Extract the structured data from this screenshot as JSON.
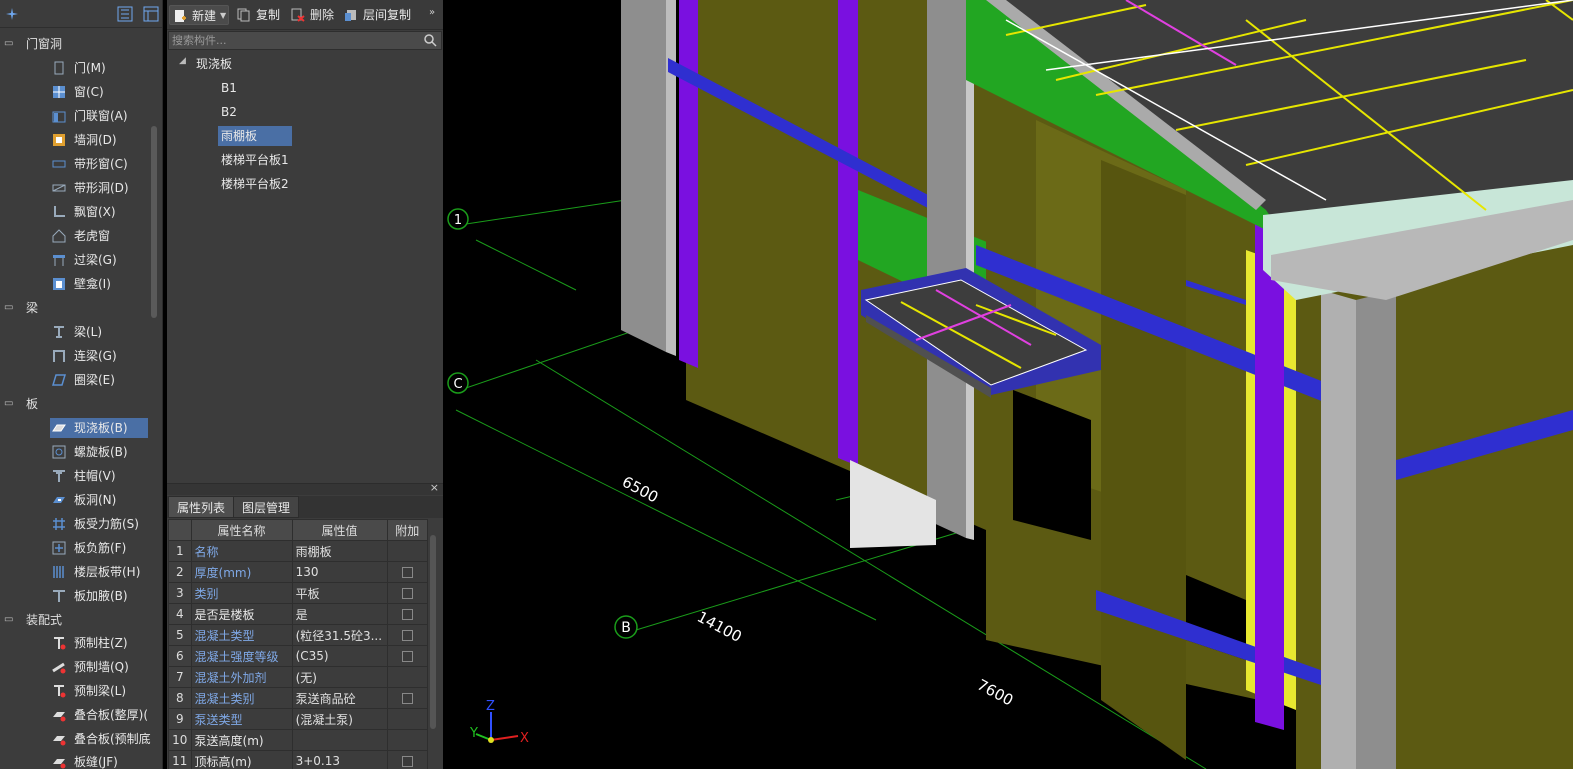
{
  "nav": {
    "categories": [
      {
        "label": "门窗洞",
        "items": [
          {
            "label": "门(M)",
            "icon": "door-icon"
          },
          {
            "label": "窗(C)",
            "icon": "window-icon"
          },
          {
            "label": "门联窗(A)",
            "icon": "door-window-icon"
          },
          {
            "label": "墙洞(D)",
            "icon": "wall-opening-icon"
          },
          {
            "label": "带形窗(C)",
            "icon": "strip-window-icon"
          },
          {
            "label": "带形洞(D)",
            "icon": "strip-opening-icon"
          },
          {
            "label": "飘窗(X)",
            "icon": "bay-window-icon"
          },
          {
            "label": "老虎窗",
            "icon": "dormer-icon"
          },
          {
            "label": "过梁(G)",
            "icon": "lintel-icon"
          },
          {
            "label": "壁龛(I)",
            "icon": "niche-icon"
          }
        ]
      },
      {
        "label": "梁",
        "items": [
          {
            "label": "梁(L)",
            "icon": "beam-icon"
          },
          {
            "label": "连梁(G)",
            "icon": "coupling-beam-icon"
          },
          {
            "label": "圈梁(E)",
            "icon": "ring-beam-icon"
          }
        ]
      },
      {
        "label": "板",
        "items": [
          {
            "label": "现浇板(B)",
            "icon": "cast-slab-icon"
          },
          {
            "label": "螺旋板(B)",
            "icon": "spiral-slab-icon"
          },
          {
            "label": "柱帽(V)",
            "icon": "column-cap-icon"
          },
          {
            "label": "板洞(N)",
            "icon": "slab-hole-icon"
          },
          {
            "label": "板受力筋(S)",
            "icon": "slab-rebar-icon"
          },
          {
            "label": "板负筋(F)",
            "icon": "slab-neg-rebar-icon"
          },
          {
            "label": "楼层板带(H)",
            "icon": "slab-strip-icon"
          },
          {
            "label": "板加腋(B)",
            "icon": "slab-haunch-icon"
          }
        ]
      },
      {
        "label": "装配式",
        "items": [
          {
            "label": "预制柱(Z)",
            "icon": "precast-column-icon"
          },
          {
            "label": "预制墙(Q)",
            "icon": "precast-wall-icon"
          },
          {
            "label": "预制梁(L)",
            "icon": "precast-beam-icon"
          },
          {
            "label": "叠合板(整厚)(",
            "icon": "composite-slab-icon"
          },
          {
            "label": "叠合板(预制底",
            "icon": "composite-slab-bottom-icon"
          },
          {
            "label": "板缝(JF)",
            "icon": "slab-joint-icon"
          }
        ]
      }
    ]
  },
  "toolbar": {
    "new_label": "新建",
    "copy_label": "复制",
    "delete_label": "删除",
    "floor_copy_label": "层间复制"
  },
  "search": {
    "placeholder": "搜索构件..."
  },
  "tree": {
    "root": "现浇板",
    "children": [
      "B1",
      "B2",
      "雨棚板",
      "楼梯平台板1",
      "楼梯平台板2"
    ],
    "selected": "雨棚板"
  },
  "props": {
    "tab_list": "属性列表",
    "tab_layers": "图层管理",
    "col_name": "属性名称",
    "col_value": "属性值",
    "col_extra": "附加",
    "rows": [
      {
        "n": "1",
        "name": "名称",
        "value": "雨棚板",
        "link": true,
        "check": false
      },
      {
        "n": "2",
        "name": "厚度(mm)",
        "value": "130",
        "link": true,
        "check": true
      },
      {
        "n": "3",
        "name": "类别",
        "value": "平板",
        "link": true,
        "check": true
      },
      {
        "n": "4",
        "name": "是否是楼板",
        "value": "是",
        "link": false,
        "check": true
      },
      {
        "n": "5",
        "name": "混凝土类型",
        "value": "(粒径31.5砼3...",
        "link": true,
        "check": true
      },
      {
        "n": "6",
        "name": "混凝土强度等级",
        "value": "(C35)",
        "link": true,
        "check": true
      },
      {
        "n": "7",
        "name": "混凝土外加剂",
        "value": "(无)",
        "link": true,
        "check": false
      },
      {
        "n": "8",
        "name": "混凝土类别",
        "value": "泵送商品砼",
        "link": true,
        "check": true
      },
      {
        "n": "9",
        "name": "泵送类型",
        "value": "(混凝土泵)",
        "link": true,
        "check": false
      },
      {
        "n": "10",
        "name": "泵送高度(m)",
        "value": "",
        "link": false,
        "check": false
      },
      {
        "n": "11",
        "name": "顶标高(m)",
        "value": "3+0.13",
        "link": false,
        "check": true
      }
    ]
  },
  "viewport": {
    "axes": {
      "a1": "1",
      "aC": "C",
      "aB": "B"
    },
    "dims": {
      "d6500": "6500",
      "d14100": "14100",
      "d7600": "7600"
    },
    "coord": {
      "x": "X",
      "y": "Y",
      "z": "Z"
    }
  },
  "colors": {
    "panel": "#3c3c3c",
    "selection": "#4a6fa5",
    "link_text": "#7fa8e6",
    "wall_olive": "#5c5a12",
    "column_grey": "#9a9a9a",
    "column_purple": "#7a10e0",
    "beam_green": "#22a622",
    "slab_dark": "#3d3d3d",
    "rebar_yellow": "#e6e600",
    "rebar_magenta": "#e040e0",
    "grid_green": "#1a9c1a"
  }
}
